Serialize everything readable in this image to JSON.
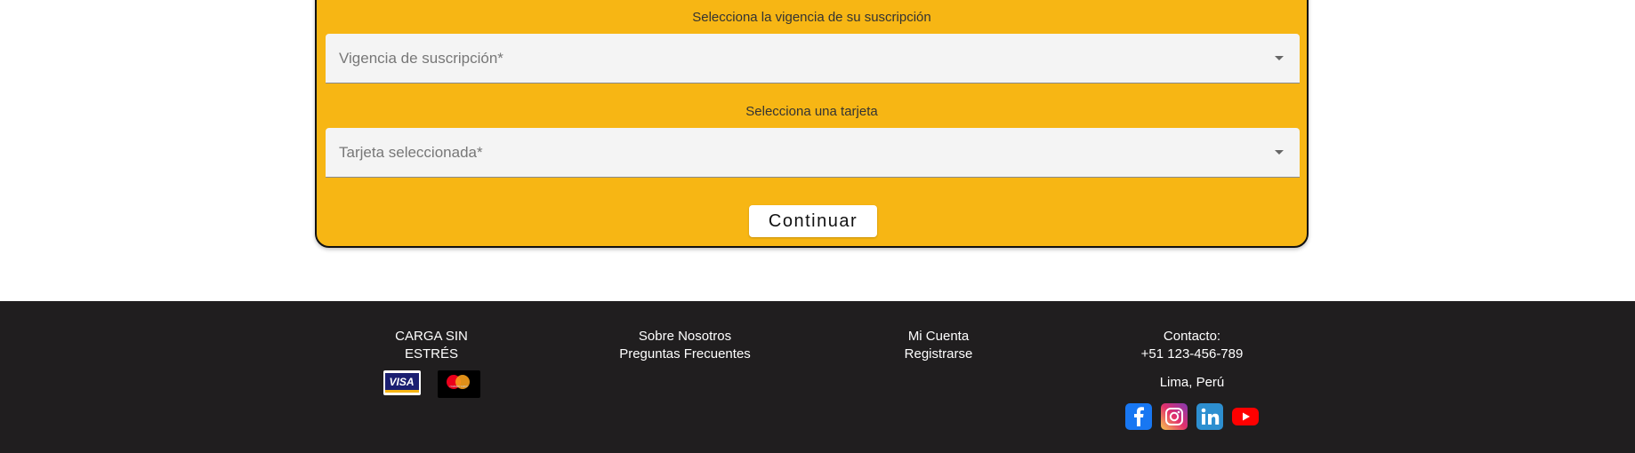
{
  "form": {
    "validity_label": "Selecciona la vigencia de su suscripción",
    "validity_placeholder": "Vigencia de suscripción*",
    "card_label": "Selecciona una tarjeta",
    "card_placeholder": "Tarjeta seleccionada*",
    "continue_label": "Continuar"
  },
  "footer": {
    "brand": "CARGA SIN ESTRÉS",
    "payment_cards": [
      "VISA",
      "mastercard"
    ],
    "links_col1": [
      "Sobre Nosotros",
      "Preguntas Frecuentes"
    ],
    "links_col2": [
      "Mi Cuenta",
      "Registrarse"
    ],
    "contact_title": "Contacto:",
    "phone": "+51 123-456-789",
    "city": "Lima, Perú",
    "socials": [
      "facebook-icon",
      "instagram-icon",
      "linkedin-icon",
      "youtube-icon"
    ]
  },
  "colors": {
    "card_bg": "#f7b614",
    "footer_bg": "#201e1f"
  }
}
